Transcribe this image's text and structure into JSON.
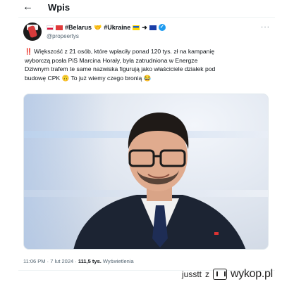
{
  "header": {
    "back_icon": "arrow-left-icon",
    "title": "Wpis"
  },
  "author": {
    "display_name_1": "#Belarus",
    "display_name_2": "#Ukraine",
    "handle": "@propeertys",
    "verified": true,
    "more_label": "···"
  },
  "tweet": {
    "line1": "Większość z 21 osób, które wpłaciły ponad 120 tys. zł na kampanię",
    "line2": "wyborczą posła PiS Marcina Horały, była zatrudniona w Energze",
    "line3": "Dziwnym trafem te same nazwiska figurują jako właściciele działek pod",
    "line4": "budowę CPK 🙃 To już wiemy czego bronią 😂",
    "exclamation": "‼️"
  },
  "footer": {
    "time": "11:06 PM",
    "date": "7 lut 2024",
    "views": "111,5 tys.",
    "views_label": "Wyświetlenia",
    "sep": "·"
  },
  "watermark": {
    "user": "jusstt",
    "z": "z",
    "site": "wykop.pl"
  },
  "colors": {
    "accent": "#1d9bf0",
    "text": "#0f1419",
    "muted": "#536471"
  }
}
